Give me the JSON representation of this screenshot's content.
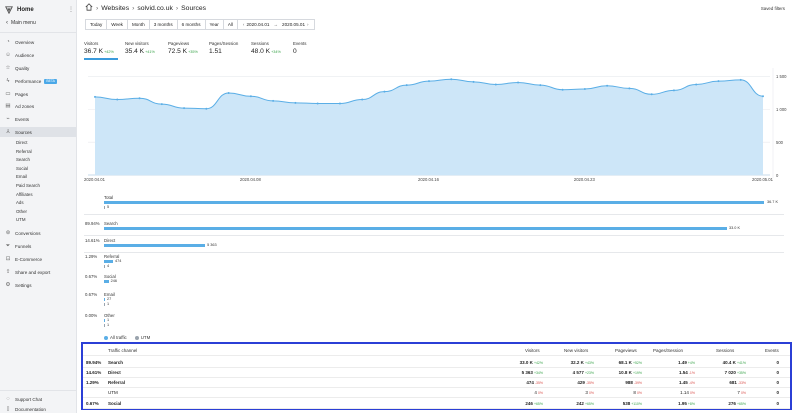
{
  "sidebar": {
    "home": "Home",
    "main_menu": "Main menu",
    "items": [
      {
        "label": "Overview",
        "icon": "gauge-icon"
      },
      {
        "label": "Audience",
        "icon": "people-icon"
      },
      {
        "label": "Quality",
        "icon": "star-icon"
      },
      {
        "label": "Performance",
        "icon": "bolt-icon",
        "badge": "BETA"
      },
      {
        "label": "Pages",
        "icon": "page-icon"
      },
      {
        "label": "Ad zones",
        "icon": "ad-icon"
      },
      {
        "label": "Events",
        "icon": "events-icon"
      },
      {
        "label": "Sources",
        "icon": "sources-icon"
      }
    ],
    "sub_items": [
      "Direct",
      "Referral",
      "Search",
      "Social",
      "Email",
      "Paid Search",
      "Affiliates",
      "Ads",
      "Other",
      "UTM"
    ],
    "items2": [
      {
        "label": "Conversions",
        "icon": "conversions-icon"
      },
      {
        "label": "Funnels",
        "icon": "funnel-icon"
      },
      {
        "label": "E-Commerce",
        "icon": "cart-icon"
      },
      {
        "label": "Share and export",
        "icon": "share-icon"
      },
      {
        "label": "Settings",
        "icon": "gear-icon"
      }
    ],
    "bottom": [
      {
        "label": "Support Chat",
        "icon": "chat-icon"
      },
      {
        "label": "Documentation",
        "icon": "book-icon"
      }
    ]
  },
  "header": {
    "crumb1": "Websites",
    "crumb2": "solvid.co.uk",
    "crumb3": "Sources",
    "saved_filters": "Saved filters"
  },
  "periods": [
    "Today",
    "Week",
    "Month",
    "3 months",
    "6 months",
    "Year",
    "All"
  ],
  "daterange": {
    "from": "2020.04.01",
    "to": "2020.05.01"
  },
  "metrics": [
    {
      "label": "Visitors",
      "value": "36.7 K",
      "change": "+42%"
    },
    {
      "label": "New visitors",
      "value": "35.4 K",
      "change": "+41%"
    },
    {
      "label": "Pageviews",
      "value": "72.5 K",
      "change": "+35%"
    },
    {
      "label": "Pages/Session",
      "value": "1.51",
      "change": ""
    },
    {
      "label": "Sessions",
      "value": "48.0 K",
      "change": "+34%"
    },
    {
      "label": "Events",
      "value": "0",
      "change": ""
    }
  ],
  "chart_data": {
    "type": "area",
    "x": [
      "2020.04.01",
      "2020.04.02",
      "2020.04.03",
      "2020.04.04",
      "2020.04.05",
      "2020.04.06",
      "2020.04.07",
      "2020.04.08",
      "2020.04.09",
      "2020.04.10",
      "2020.04.11",
      "2020.04.12",
      "2020.04.13",
      "2020.04.14",
      "2020.04.15",
      "2020.04.16",
      "2020.04.17",
      "2020.04.18",
      "2020.04.19",
      "2020.04.20",
      "2020.04.21",
      "2020.04.22",
      "2020.04.23",
      "2020.04.24",
      "2020.04.25",
      "2020.04.26",
      "2020.04.27",
      "2020.04.28",
      "2020.04.29",
      "2020.04.30",
      "2020.05.01"
    ],
    "series": [
      {
        "values": [
          1190,
          1150,
          1170,
          1080,
          1020,
          1010,
          1250,
          1200,
          1130,
          1100,
          1090,
          1090,
          1150,
          1270,
          1370,
          1430,
          1460,
          1420,
          1380,
          1410,
          1370,
          1300,
          1310,
          1360,
          1320,
          1230,
          1290,
          1380,
          1430,
          1450,
          1200
        ]
      }
    ],
    "x_ticks": [
      "2020.04.01",
      "2020.04.08",
      "2020.04.16",
      "2020.04.23",
      "2020.05.01"
    ],
    "y_ticks": [
      "1 500",
      "1 000",
      "500",
      "0"
    ],
    "ylim": [
      0,
      1600
    ]
  },
  "bars": {
    "total_label": "Total",
    "total_value": "36.7 K",
    "total_sub": "5",
    "groups": [
      {
        "name": "Search",
        "pct": "89.94%",
        "value": "33.0 K",
        "frac": 0.9
      },
      {
        "name": "Direct",
        "pct": "14.61%",
        "value": "5 363",
        "frac": 0.146
      },
      {
        "name": "Referral",
        "pct": "1.29%",
        "value": "474",
        "frac": 0.013,
        "sub": "4"
      },
      {
        "name": "Social",
        "pct": "0.67%",
        "value": "246",
        "frac": 0.0067
      },
      {
        "name": "Email",
        "pct": "0.67%",
        "value": "27",
        "frac": 0.0007,
        "sub": "1"
      },
      {
        "name": "Other",
        "pct": "0.00%",
        "value": "1",
        "frac": 0.0,
        "sub": "1"
      }
    ],
    "legend": [
      {
        "label": "All traffic",
        "color": "#5aaee6"
      },
      {
        "label": "UTM",
        "color": "#9aa3ad"
      }
    ]
  },
  "table": {
    "headers": [
      "Traffic channel",
      "Visitors",
      "New visitors",
      "Pageviews",
      "Pages/Session",
      "Sessions",
      "Events"
    ],
    "rows": [
      {
        "pct": "89.94%",
        "name": "Search",
        "bold": true,
        "visitors": "33.0 K",
        "v_d": "+42%",
        "new": "32.2 K",
        "n_d": "+43%",
        "pv": "68.1 K",
        "p_d": "+52%",
        "ps": "1.49",
        "ps_d": "+4%",
        "sess": "40.4 K",
        "s_d": "+41%",
        "ev": "0"
      },
      {
        "pct": "14.61%",
        "name": "Direct",
        "bold": true,
        "visitors": "5 363",
        "v_d": "+34%",
        "new": "4 577",
        "n_d": "+23%",
        "pv": "10.8 K",
        "p_d": "+19%",
        "ps": "1.54",
        "ps_d": "-1%",
        "sess": "7 020",
        "s_d": "+35%",
        "ev": "0"
      },
      {
        "pct": "1.29%",
        "name": "Referral",
        "bold": true,
        "visitors": "474",
        "v_d": "-35%",
        "new": "429",
        "n_d": "-35%",
        "pv": "988",
        "p_d": "-39%",
        "ps": "1.45",
        "ps_d": "-4%",
        "sess": "681",
        "s_d": "-33%",
        "ev": "0"
      },
      {
        "pct": "",
        "name": "UTM",
        "bold": false,
        "visitors": "4",
        "v_d": "0%",
        "new": "3",
        "n_d": "0%",
        "pv": "8",
        "p_d": "0%",
        "ps": "1.14",
        "ps_d": "0%",
        "sess": "7",
        "s_d": "0%",
        "ev": "0"
      },
      {
        "pct": "0.67%",
        "name": "Social",
        "bold": true,
        "visitors": "246",
        "v_d": "+65%",
        "new": "242",
        "n_d": "+65%",
        "pv": "538",
        "p_d": "+110%",
        "ps": "1.95",
        "ps_d": "+8%",
        "sess": "276",
        "s_d": "+65%",
        "ev": "0"
      }
    ]
  }
}
